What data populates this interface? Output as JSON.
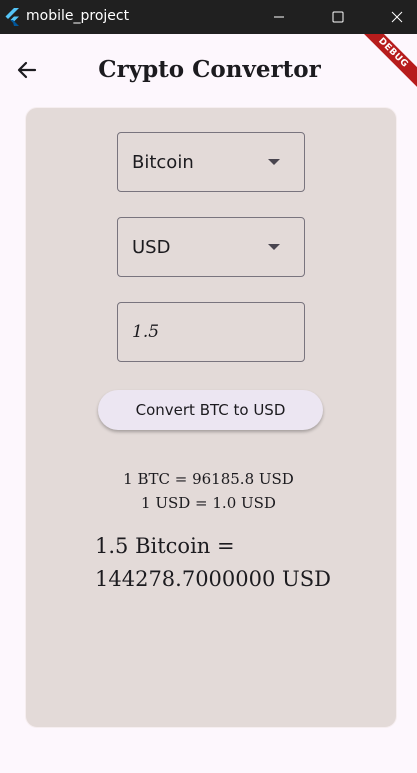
{
  "window": {
    "title": "mobile_project",
    "logo_icon": "flutter-logo-icon",
    "minimize_icon": "minimize-icon",
    "maximize_icon": "maximize-icon",
    "close_icon": "close-icon"
  },
  "debug_banner": {
    "label": "DEBUG",
    "color": "#b71c1c"
  },
  "app_bar": {
    "back_icon": "arrow-left-icon",
    "title": "Crypto Convertor"
  },
  "form": {
    "crypto_select": {
      "value": "Bitcoin",
      "icon": "dropdown-arrow-icon"
    },
    "currency_select": {
      "value": "USD",
      "icon": "dropdown-arrow-icon"
    },
    "amount_input": {
      "value": "1.5"
    },
    "convert_button": {
      "label": "Convert BTC to USD"
    }
  },
  "rates": {
    "crypto_rate": "1 BTC = 96185.8 USD",
    "currency_rate": "1 USD = 1.0 USD"
  },
  "result": {
    "text": "1.5 Bitcoin = 144278.7000000 USD"
  },
  "colors": {
    "card_background": "#e3dad8",
    "page_background": "#fdf7fd",
    "button_background": "#ece6f2",
    "titlebar_background": "#202020"
  }
}
